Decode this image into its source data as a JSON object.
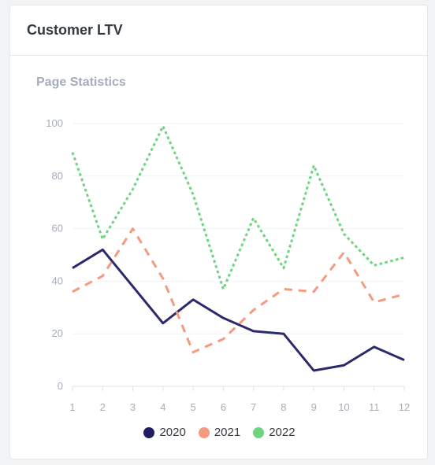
{
  "card": {
    "title": "Customer LTV"
  },
  "chart_data": {
    "type": "line",
    "title": "Page Statistics",
    "x": [
      1,
      2,
      3,
      4,
      5,
      6,
      7,
      8,
      9,
      10,
      11,
      12
    ],
    "xlabel": "",
    "ylabel": "",
    "ylim": [
      0,
      100
    ],
    "yticks": [
      0,
      20,
      40,
      60,
      80,
      100
    ],
    "grid": true,
    "legend_position": "bottom",
    "series": [
      {
        "name": "2020",
        "color": "#2b2a6b",
        "style": "solid",
        "values": [
          45,
          52,
          38,
          24,
          33,
          26,
          21,
          20,
          6,
          8,
          15,
          10
        ]
      },
      {
        "name": "2021",
        "color": "#f59a7e",
        "style": "dashed",
        "values": [
          36,
          42,
          60,
          41,
          13,
          18,
          29,
          37,
          36,
          51,
          32,
          35
        ]
      },
      {
        "name": "2022",
        "color": "#6fd47f",
        "style": "dotted",
        "values": [
          89,
          56,
          75,
          99,
          73,
          37,
          64,
          45,
          84,
          58,
          46,
          49
        ]
      }
    ]
  }
}
